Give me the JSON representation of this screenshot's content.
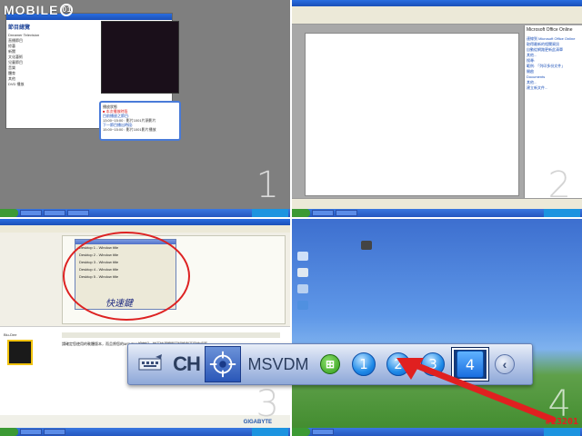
{
  "logo": {
    "text": "MOBILE",
    "suffix": "01"
  },
  "panels": [
    {
      "number": "1"
    },
    {
      "number": "2"
    },
    {
      "number": "3"
    },
    {
      "number": "4"
    }
  ],
  "q1": {
    "heading": "節目總覽",
    "sidebar_items": [
      "Dreamer Television",
      "直播節目",
      "綜藝",
      "新聞",
      "文化藝術",
      "兒童節目",
      "音樂",
      "體育",
      "其他",
      "DVD 播放"
    ],
    "popup_lines": [
      {
        "text": "播放狀態",
        "color": "normal"
      },
      {
        "text": "■ 本次播放時段",
        "color": "red"
      },
      {
        "text": "目前播放之節目:",
        "color": "blue"
      },
      {
        "text": "13:00~15:00 : 影片1001片頭影片",
        "color": "normal"
      },
      {
        "text": "下一節目播出時段:",
        "color": "blue"
      },
      {
        "text": "15:00~15:00 : 影片1001影片播放",
        "color": "normal"
      }
    ]
  },
  "q2": {
    "taskpane_title": "Microsoft Office Online",
    "taskpane_links": [
      "連線到 Microsoft Office Online",
      "取得最新的相關資訊",
      "自動從網路更新此清單",
      "其他...",
      "搜尋:",
      "範例: 「列印多份文件」",
      "開啟",
      "Documents",
      "其他...",
      "建立新文件..."
    ]
  },
  "q3": {
    "dialog_rows": [
      "Desktop 1 - Window title",
      "Desktop 2 - Window title",
      "Desktop 3 - Window title",
      "Desktop 4 - Window title",
      "Desktop 5 - Window title"
    ],
    "handwriting": "快速鍵",
    "post_user": "Blu-Dee",
    "post_text": "請確定您使用的軟體版本，而且將您的MSVDM 設定好，按下快速鍵即可切換到不同的桌面。",
    "footer_brand": "GIGABYTE"
  },
  "pager": {
    "ch_label": "CH",
    "ms_label": "MSVDM",
    "grid_symbol": "⊞",
    "desktops": [
      "1",
      "2",
      "3",
      "4"
    ],
    "active_desktop": "4",
    "back_symbol": "‹"
  },
  "watermark": "#23201",
  "colors": {
    "arrow": "#e02020",
    "accent": "#1e8ae8"
  }
}
